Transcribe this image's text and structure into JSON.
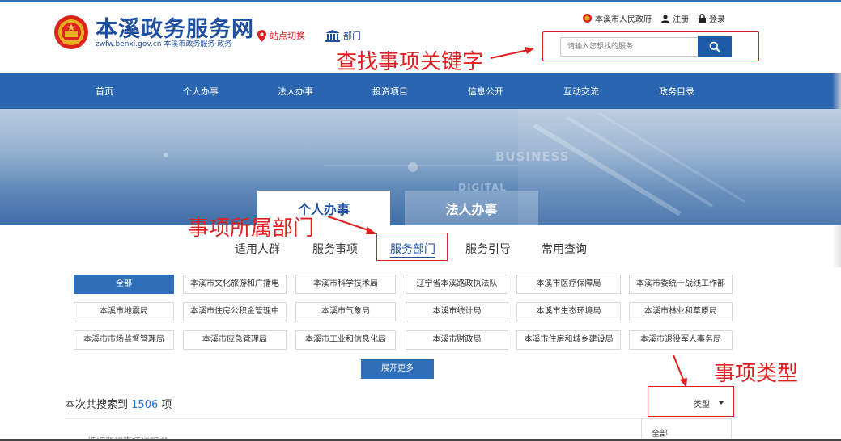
{
  "header": {
    "site_title": "本溪政务服务网",
    "site_subtitle": "zwfw.benxi.gov.cn  本溪市政务服务·政务",
    "site_switch": "站点切换",
    "dept_link": "部门",
    "top_links": {
      "gov": "本溪市人民政府",
      "register": "注册",
      "login": "登录"
    },
    "search": {
      "placeholder": "请输入您想找的服务"
    }
  },
  "annotations": {
    "search_hint": "查找事项关键字",
    "dept_hint": "事项所属部门",
    "type_hint": "事项类型"
  },
  "nav": {
    "items": [
      "首页",
      "个人办事",
      "法人办事",
      "投资项目",
      "信息公开",
      "互动交流",
      "政务目录"
    ]
  },
  "banner": {
    "words": [
      "BUSINESS",
      "DIGITAL"
    ],
    "tab_personal": "个人办事",
    "tab_legal": "法人办事"
  },
  "subtabs": [
    "适用人群",
    "服务事项",
    "服务部门",
    "服务引导",
    "常用查询"
  ],
  "departments": [
    [
      "全部",
      "本溪市文化旅游和广播电",
      "本溪市科学技术局",
      "辽宁省本溪路政执法队",
      "本溪市医疗保障局",
      "本溪市委统一战线工作部"
    ],
    [
      "本溪市地震局",
      "本溪市住房公积金管理中",
      "本溪市气象局",
      "本溪市统计局",
      "本溪市生态环境局",
      "本溪市林业和草原局"
    ],
    [
      "本溪市市场监督管理局",
      "本溪市应急管理局",
      "本溪市工业和信息化局",
      "本溪市财政局",
      "本溪市住房和城乡建设局",
      "本溪市退役军人事务局"
    ]
  ],
  "expand_label": "展开更多",
  "results": {
    "prefix": "本次共搜索到",
    "count": "1506",
    "suffix": "项"
  },
  "type_filter": {
    "label": "类型",
    "options": [
      "全部"
    ]
  },
  "partial_item": "婚姻登记事项证明书",
  "colors": {
    "primary": "#2a65b2",
    "annotation": "#e02020"
  }
}
